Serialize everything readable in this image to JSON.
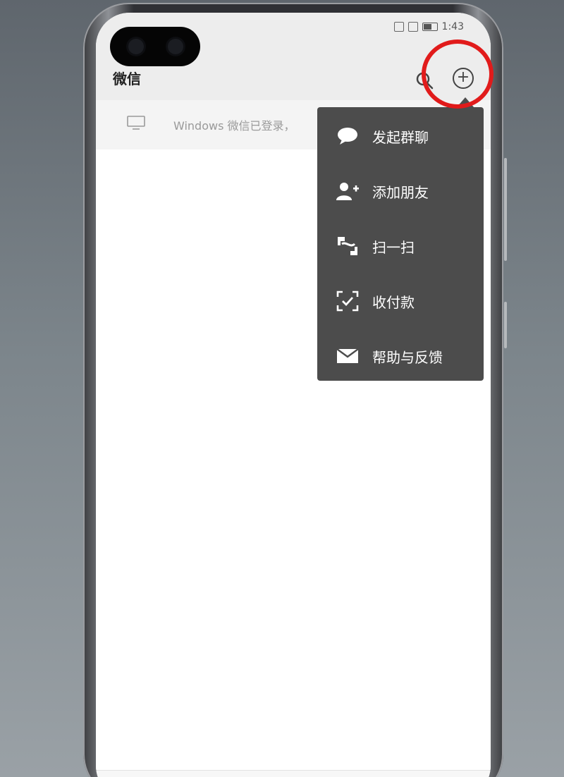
{
  "status_bar": {
    "time": "1:43"
  },
  "header": {
    "title": "微信",
    "search_icon": "search-icon",
    "add_icon": "plus-circle-icon"
  },
  "notice": {
    "text": "Windows 微信已登录，",
    "icon": "monitor-icon"
  },
  "popup_menu": {
    "items": [
      {
        "label": "发起群聊",
        "icon": "chat-bubble-icon"
      },
      {
        "label": "添加朋友",
        "icon": "add-person-icon"
      },
      {
        "label": "扫一扫",
        "icon": "scan-icon"
      },
      {
        "label": "收付款",
        "icon": "payment-scan-icon"
      },
      {
        "label": "帮助与反馈",
        "icon": "envelope-icon"
      }
    ]
  },
  "colors": {
    "menu_bg": "#4c4c4c",
    "header_bg": "#ededed",
    "highlight_circle": "#e11b1b",
    "wechat_green": "#07c160"
  }
}
